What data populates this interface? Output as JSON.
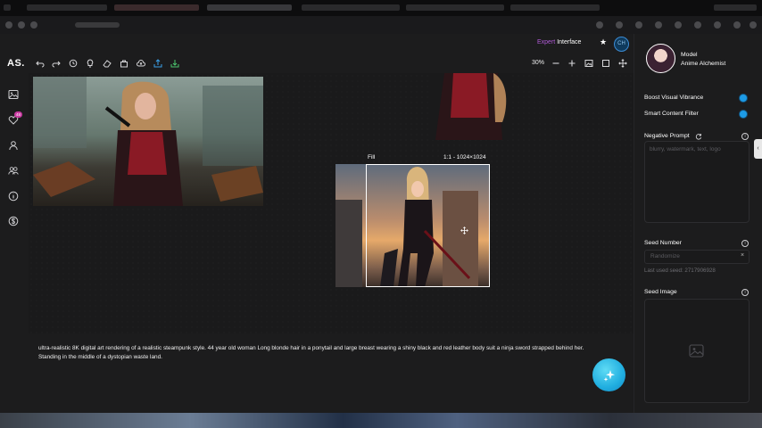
{
  "header": {
    "expert_prefix": "Expert",
    "expert_suffix": "Interface",
    "user_initials": "CH"
  },
  "app": {
    "logo": "AS."
  },
  "sidebar": {
    "favorites_badge": "48"
  },
  "toolbar": {
    "zoom": "30%"
  },
  "canvas": {
    "fill_label": "Fill",
    "size_label": "1:1 - 1024×1024"
  },
  "prompt": {
    "text": "ultra-realistic 8K digital art rendering of a realistic steampunk style. 44 year old woman Long blonde hair in a ponytail and large breast wearing a shiny black and red leather body suit a ninja sword strapped behind her. Standing in the middle of a dystopian waste land."
  },
  "panel": {
    "model_title": "Model",
    "model_name": "Anime Alchemist",
    "boost_label": "Boost Visual Vibrance",
    "filter_label": "Smart Content Filter",
    "negative_label": "Negative Prompt",
    "negative_placeholder": "blurry, watermark, text, logo",
    "seed_label": "Seed Number",
    "seed_placeholder": "Randomize",
    "last_seed": "Last used seed: 2717906928",
    "seed_image_label": "Seed Image"
  },
  "colors": {
    "accent": "#1d9be6",
    "expert": "#b05ad6",
    "badge": "#c83aa0"
  }
}
